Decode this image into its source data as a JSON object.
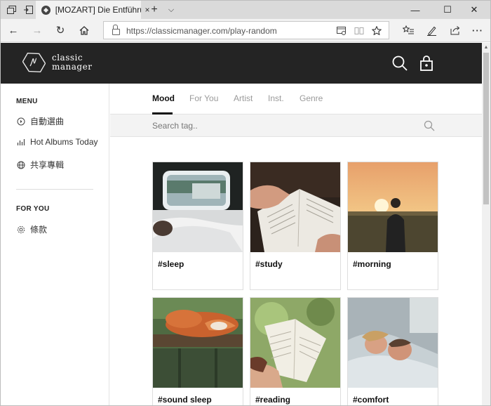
{
  "browser": {
    "tab_title": "[MOZART] Die Entführu",
    "tab_close_icon": "×",
    "new_tab_icon": "+",
    "tab_list_icon": "⌵",
    "window_controls": {
      "minimize": "—",
      "maximize": "☐",
      "close": "✕"
    },
    "url": "https://classicmanager.com/play-random",
    "nav": {
      "back": "←",
      "forward": "→",
      "refresh": "↻",
      "home": "⌂"
    }
  },
  "site": {
    "logo_line1": "classic",
    "logo_line2": "manager"
  },
  "sidebar": {
    "menu_heading": "MENU",
    "menu_items": [
      {
        "label": "自動選曲",
        "icon": "play-circle-icon"
      },
      {
        "label": "Hot Albums Today",
        "icon": "bar-chart-icon"
      },
      {
        "label": "共享專輯",
        "icon": "globe-icon"
      }
    ],
    "foryou_heading": "FOR YOU",
    "foryou_items": [
      {
        "label": "條款",
        "icon": "gear-icon"
      }
    ]
  },
  "main": {
    "tabs": [
      {
        "label": "Mood",
        "active": true
      },
      {
        "label": "For You",
        "active": false
      },
      {
        "label": "Artist",
        "active": false
      },
      {
        "label": "Inst.",
        "active": false
      },
      {
        "label": "Genre",
        "active": false
      }
    ],
    "search_placeholder": "Search tag..",
    "cards": [
      {
        "tag": "#sleep"
      },
      {
        "tag": "#study"
      },
      {
        "tag": "#morning"
      },
      {
        "tag": "#sound sleep"
      },
      {
        "tag": "#reading"
      },
      {
        "tag": "#comfort"
      }
    ]
  },
  "colors": {
    "header_bg": "#242424",
    "accent": "#111111",
    "muted_tab": "#9a9a9a"
  }
}
